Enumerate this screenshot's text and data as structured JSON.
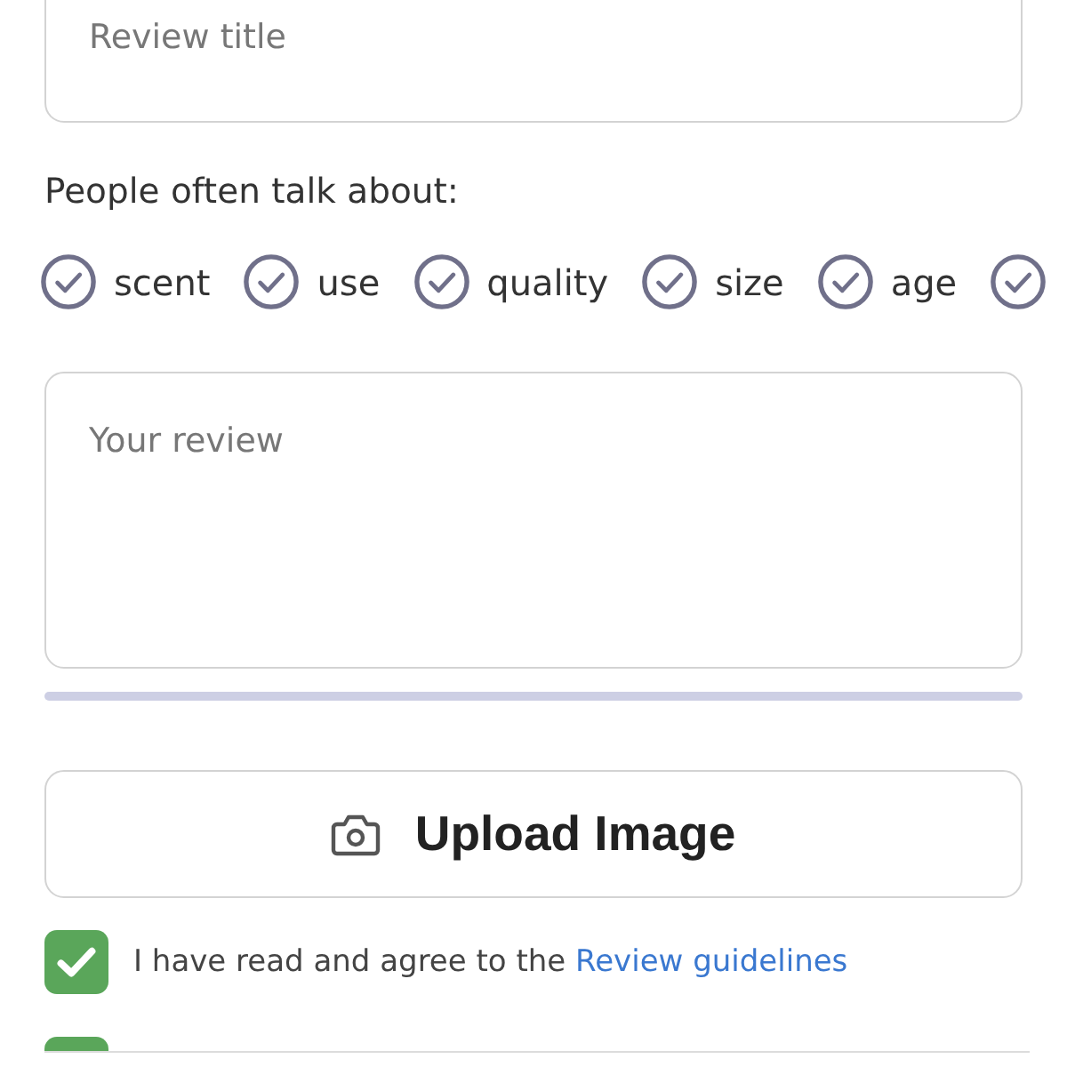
{
  "title_field": {
    "placeholder": "Review title"
  },
  "topics": {
    "heading": "People often talk about:",
    "tags": [
      {
        "label": "scent",
        "selected": false
      },
      {
        "label": "use",
        "selected": false
      },
      {
        "label": "quality",
        "selected": false
      },
      {
        "label": "size",
        "selected": false
      },
      {
        "label": "age",
        "selected": false
      },
      {
        "selected": false
      }
    ]
  },
  "review_field": {
    "placeholder": "Your review"
  },
  "upload_button": {
    "label": "Upload Image"
  },
  "agreements": [
    {
      "text": "I have read and agree to the",
      "link": "Review guidelines",
      "checked": true
    },
    {
      "checked": true
    }
  ]
}
